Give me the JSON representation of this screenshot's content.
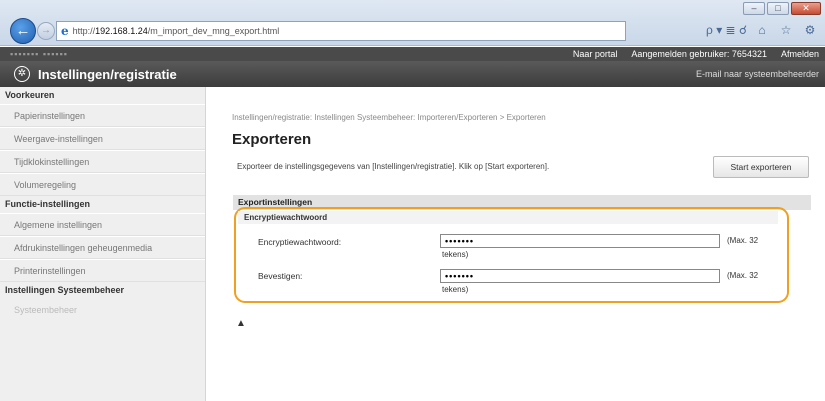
{
  "browser": {
    "url_prefix": "http://",
    "url_host": "192.168.1.24",
    "url_path": "/m_import_dev_mng_export.html",
    "search_label": "ρ ▾ ≣ ☌",
    "home_icon": "home-icon",
    "favorites_icon": "star-icon"
  },
  "topbar": {
    "device_name": "▪▪▪▪▪▪▪ ▪▪▪▪▪▪",
    "portal_link": "Naar portal",
    "user_label": "Aangemelden gebruiker: 7654321",
    "logout_link": "Afmelden"
  },
  "header": {
    "title": "Instellingen/registratie",
    "mail_link": "E-mail naar systeembeheerder"
  },
  "sidebar": {
    "sections": [
      {
        "heading": "Voorkeuren",
        "items": [
          "Papierinstellingen",
          "Weergave-instellingen",
          "Tijdklokinstellingen",
          "Volumeregeling"
        ]
      },
      {
        "heading": "Functie-instellingen",
        "items": [
          "Algemene instellingen",
          "Afdrukinstellingen geheugenmedia",
          "Printerinstellingen"
        ]
      },
      {
        "heading": "Instellingen Systeembeheer",
        "items": [
          "Systeembeheer"
        ]
      }
    ]
  },
  "main": {
    "breadcrumb": "Instellingen/registratie: Instellingen Systeembeheer: Importeren/Exporteren > Exporteren",
    "page_title": "Exporteren",
    "description": "Exporteer de instellingsgegevens van [Instellingen/registratie]. Klik op [Start exporteren].",
    "start_button": "Start exporteren",
    "section_heading": "Exportinstellingen",
    "subsection_heading": "Encryptiewachtwoord",
    "fields": [
      {
        "label": "Encryptiewachtwoord:",
        "value": "•••••••",
        "hint_a": "(Max. 32",
        "hint_b": "tekens)"
      },
      {
        "label": "Bevestigen:",
        "value": "•••••••",
        "hint_a": "(Max. 32",
        "hint_b": "tekens)"
      }
    ],
    "back_to_top": "▲"
  }
}
